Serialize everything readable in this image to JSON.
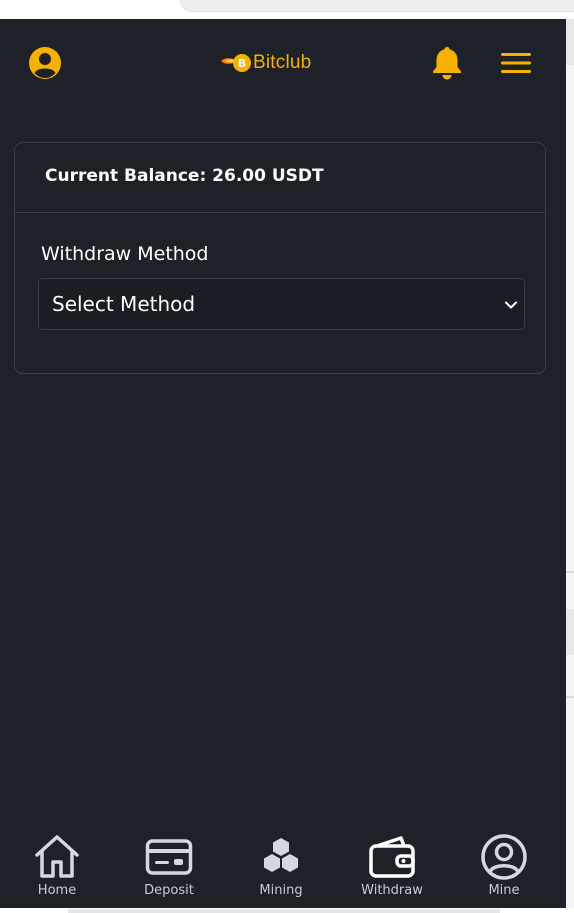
{
  "header": {
    "brand_prefix": "B",
    "brand_name": "Bitclub",
    "user_icon": "user-circle-icon",
    "bell_icon": "bell-icon",
    "menu_icon": "hamburger-menu-icon"
  },
  "balance": {
    "text": "Current Balance: 26.00 USDT"
  },
  "withdraw": {
    "label": "Withdraw Method",
    "select_value": "Select Method"
  },
  "nav": {
    "items": [
      {
        "label": "Home",
        "icon": "home-icon"
      },
      {
        "label": "Deposit",
        "icon": "card-icon"
      },
      {
        "label": "Mining",
        "icon": "hexagons-icon"
      },
      {
        "label": "Withdraw",
        "icon": "wallet-icon"
      },
      {
        "label": "Mine",
        "icon": "user-circle-icon"
      }
    ]
  },
  "colors": {
    "background": "#1f2129",
    "accent": "#f5b200",
    "border": "#3a3d47",
    "nav_icon": "#d6d8df"
  }
}
